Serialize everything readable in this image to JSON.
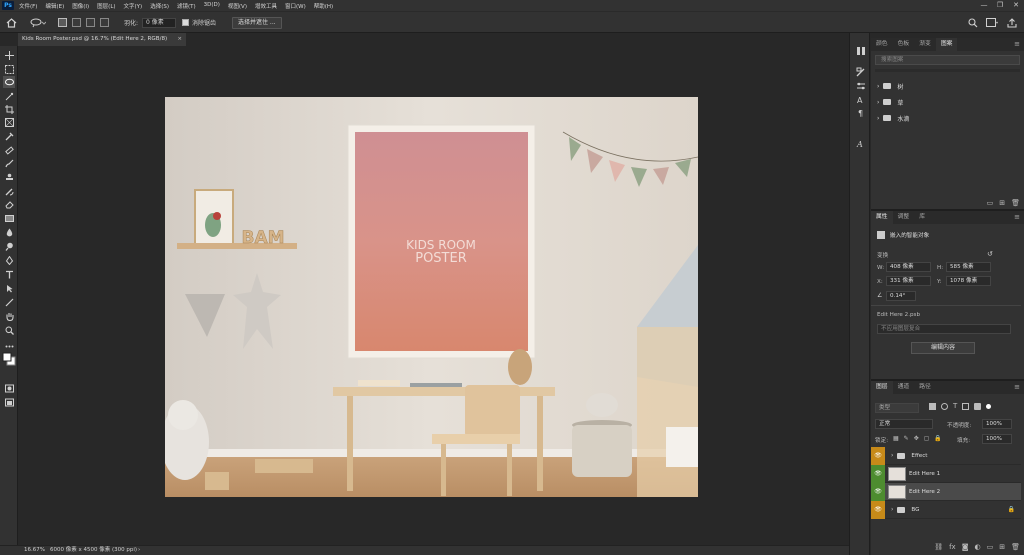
{
  "app": {
    "logo": "Ps",
    "menu": [
      "文件(F)",
      "编辑(E)",
      "图像(I)",
      "图层(L)",
      "文字(Y)",
      "选择(S)",
      "滤镜(T)",
      "3D(D)",
      "视图(V)",
      "增效工具",
      "窗口(W)",
      "帮助(H)"
    ],
    "window_controls": [
      "—",
      "❐",
      "✕"
    ]
  },
  "options": {
    "feather_label": "羽化:",
    "feather_value": "0 像素",
    "antialias_label": "消除锯齿",
    "select_mask_button": "选择并遮住 ..."
  },
  "document": {
    "tab_title": "Kids Room Poster.psd @ 16.7% (Edit Here 2, RGB/8)",
    "close": "×"
  },
  "canvas": {
    "poster_title": "KIDS ROOM",
    "poster_subtitle": "POSTER",
    "shelf_text": "BAM"
  },
  "status": {
    "zoom": "16.67%",
    "doc_info": "6000 像素 x 4500 像素 (300 ppi)",
    "arrow": "›"
  },
  "panel_top": {
    "tabs": [
      "颜色",
      "色板",
      "渐变",
      "图案"
    ],
    "active_tab": "图案",
    "search_placeholder": "搜索图案",
    "folders": [
      "树",
      "草",
      "水滴"
    ]
  },
  "panel_props": {
    "tabs": [
      "属性",
      "调整",
      "库"
    ],
    "active_tab": "属性",
    "object_type": "嵌入的智能对象",
    "section": "变换",
    "w_label": "W:",
    "w_value": "408 像素",
    "h_label": "H:",
    "h_value": "585 像素",
    "x_label": "X:",
    "x_value": "331 像素",
    "y_label": "Y:",
    "y_value": "1078 像素",
    "angle_value": "0.14°",
    "filename": "Edit Here 2.psb",
    "layer_comp": "不应用图层复合",
    "edit_button": "编辑内容"
  },
  "panel_layers": {
    "tabs": [
      "图层",
      "通道",
      "路径"
    ],
    "active_tab": "图层",
    "filter_label": "类型",
    "blend_mode": "正常",
    "opacity_label": "不透明度:",
    "opacity_value": "100%",
    "lock_label": "锁定:",
    "fill_label": "填充:",
    "fill_value": "100%",
    "layers": [
      {
        "name": "Effect",
        "kind": "folder"
      },
      {
        "name": "Edit Here 1",
        "kind": "smart"
      },
      {
        "name": "Edit Here 2",
        "kind": "smart",
        "selected": true
      },
      {
        "name": "BG",
        "kind": "folder",
        "locked": true
      }
    ]
  },
  "colors": {
    "accent": "#31a8ff",
    "eye_orange": "#c78a19",
    "eye_green": "#4d8c2f",
    "poster_pink": "#d98f8a"
  }
}
